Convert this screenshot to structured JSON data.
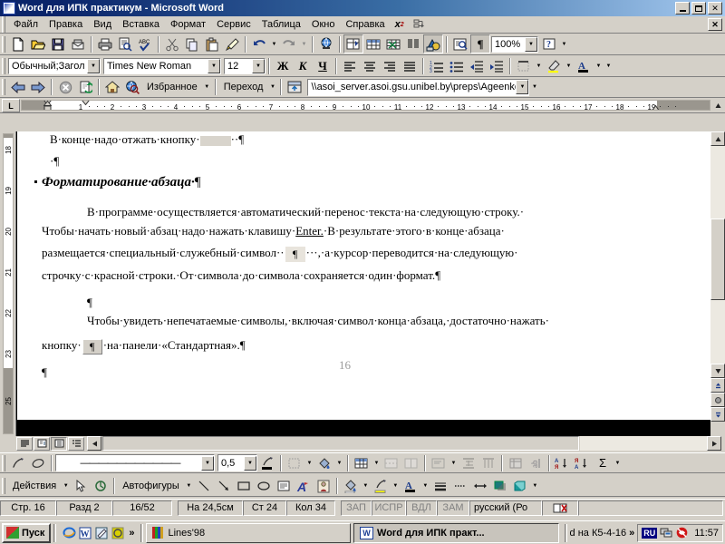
{
  "window": {
    "title": "Word для  ИПК практикум - Microsoft Word",
    "app_icon": "word-document-icon",
    "minimize": "_",
    "restore": "❐",
    "close": "✕"
  },
  "menubar": {
    "items": [
      {
        "label": "Файл",
        "accel": "Ф"
      },
      {
        "label": "Правка",
        "accel": "П"
      },
      {
        "label": "Вид",
        "accel": "и"
      },
      {
        "label": "Вставка",
        "accel": "а"
      },
      {
        "label": "Формат",
        "accel": "о"
      },
      {
        "label": "Сервис",
        "accel": "е"
      },
      {
        "label": "Таблица",
        "accel": "Т"
      },
      {
        "label": "Окно",
        "accel": "О"
      },
      {
        "label": "Справка",
        "accel": "С"
      }
    ],
    "superscript_icon": "x-squared-icon",
    "insert_field_icon": "insert-field-icon",
    "close_document": "✕"
  },
  "standard_toolbar": {
    "buttons": [
      {
        "name": "new-document-button",
        "glyph": "🗋"
      },
      {
        "name": "open-folder-button",
        "glyph": "🗀"
      },
      {
        "name": "save-button",
        "glyph": "💾"
      },
      {
        "name": "email-button",
        "glyph": "✉"
      },
      {
        "name": "print-button",
        "glyph": "🖶"
      },
      {
        "name": "print-preview-button",
        "glyph": "🔍"
      },
      {
        "name": "spelling-check-button",
        "glyph": "ABC"
      },
      {
        "name": "cut-button",
        "glyph": "✂"
      },
      {
        "name": "copy-button",
        "glyph": "⧉"
      },
      {
        "name": "paste-button",
        "glyph": "📋"
      },
      {
        "name": "format-painter-button",
        "glyph": "🖌"
      },
      {
        "name": "undo-button",
        "glyph": "↶"
      },
      {
        "name": "redo-button",
        "glyph": "↷"
      },
      {
        "name": "insert-hyperlink-button",
        "glyph": "🌐"
      },
      {
        "name": "tables-and-borders-button",
        "glyph": "⊞"
      },
      {
        "name": "insert-table-button",
        "glyph": "▦"
      },
      {
        "name": "insert-excel-sheet-button",
        "glyph": "▤"
      },
      {
        "name": "columns-button",
        "glyph": "▥"
      },
      {
        "name": "drawing-button",
        "glyph": "◆"
      },
      {
        "name": "document-map-button",
        "glyph": "🔎"
      },
      {
        "name": "show-formatting-marks-button",
        "glyph": "¶"
      },
      {
        "name": "help-button",
        "glyph": "?"
      }
    ],
    "zoom_value": "100%"
  },
  "formatting_toolbar": {
    "style_value": "Обычный;Загол",
    "font_value": "Times New Roman",
    "size_value": "12",
    "bold_label": "Ж",
    "italic_label": "К",
    "underline_label": "Ч",
    "buttons": [
      {
        "name": "align-left-button",
        "glyph": "≡"
      },
      {
        "name": "align-center-button",
        "glyph": "≡"
      },
      {
        "name": "align-right-button",
        "glyph": "≡"
      },
      {
        "name": "align-justify-button",
        "glyph": "≡"
      },
      {
        "name": "numbered-list-button",
        "glyph": "⒈"
      },
      {
        "name": "bulleted-list-button",
        "glyph": "•"
      },
      {
        "name": "decrease-indent-button",
        "glyph": "⇤"
      },
      {
        "name": "increase-indent-button",
        "glyph": "⇥"
      },
      {
        "name": "borders-button",
        "glyph": "▣"
      },
      {
        "name": "highlight-color-button",
        "glyph": "🖍"
      },
      {
        "name": "font-color-button",
        "glyph": "A"
      }
    ]
  },
  "web_toolbar": {
    "back_label": "⬅",
    "forward_label": "➡",
    "stop_label": "✖",
    "refresh_label": "⟳",
    "home_label": "⌂",
    "search_label": "search-web-icon",
    "favorites_label": "Избранное",
    "go_label": "Переход",
    "show_only_web_toolbar_label": "show-only-web-toolbar-icon",
    "address_value": "\\\\asoi_server.asoi.gsu.unibel.by\\preps\\Ageenko\\W("
  },
  "ruler": {
    "tab_stop_indicator": "L",
    "h_ticks": [
      "1",
      "2",
      "3",
      "4",
      "5",
      "6",
      "7",
      "8",
      "9",
      "10",
      "11",
      "12",
      "13",
      "14",
      "15",
      "16",
      "17",
      "18",
      "19"
    ],
    "v_ticks": [
      "18",
      "19",
      "20",
      "21",
      "22",
      "23",
      "25"
    ]
  },
  "document": {
    "line_top_partial": "В·конце·надо·отжать·кнопку·",
    "line_top_pilcrow": "¶",
    "empty_para_mark": "·¶",
    "heading": "Форматирование·абзаца·",
    "heading_mark": "¶",
    "para1_line1": "В·программе·осуществляется·автоматический·перенос·текста·на·следующую·строку.·",
    "para1_line2a": "Чтобы·начать·новый·абзац·надо·нажать·клавишу·",
    "para1_link": "Enter.",
    "para1_line2b": "·В·результате·этого·в·конце·абзаца·",
    "para1_line3a": "размещается·специальный·служебный·символ··",
    "para1_inline_mark": "¶",
    "para1_line3b": "···,·а·курсор·переводится·на·следующую·",
    "para1_line4": "строчку·с·красной·строки.·От·символа·до·символа·сохраняется·один·формат.",
    "para1_end_mark": "¶",
    "middle_mark": "¶",
    "para2_line1": "Чтобы·увидеть·непечатаемые·символы,·включая·символ·конца·абзаца,·достаточно·нажать·",
    "para2_line2a": "кнопку·",
    "para2_button_glyph": "¶",
    "para2_line2b": "·на·панели·«Стандартная».",
    "para2_end_mark": "¶",
    "footer_mark": "¶",
    "page_number": "16"
  },
  "view_buttons": [
    {
      "name": "normal-view-button",
      "glyph": "≡",
      "active": false
    },
    {
      "name": "web-layout-view-button",
      "glyph": "🖵",
      "active": false
    },
    {
      "name": "print-layout-view-button",
      "glyph": "▤",
      "active": true
    },
    {
      "name": "outline-view-button",
      "glyph": "⋮≡",
      "active": false
    }
  ],
  "tables_borders_toolbar": {
    "draw_table_label": "draw-table-pencil-icon",
    "eraser_label": "eraser-icon",
    "line_style_value": "———————————",
    "line_weight_value": "0,5",
    "border_color_label": "border-color-pencil-icon",
    "outside_border_label": "outside-border-icon",
    "shading_color_label": "shading-color-icon",
    "insert_table_label": "insert-table-icon",
    "merge_cells_label": "merge-cells-icon",
    "split_cells_label": "split-cells-icon",
    "align_label": "align-cell-icon",
    "distribute_rows_label": "distribute-rows-icon",
    "distribute_cols_label": "distribute-columns-icon",
    "table_autoformat_label": "table-autoformat-icon",
    "change_text_direction_label": "text-direction-icon",
    "sort_ascending_label": "А Я",
    "sort_descending_label": "Я А",
    "autosum_label": "Σ"
  },
  "drawing_toolbar": {
    "actions_label": "Действия",
    "select_objects_label": "select-arrow-icon",
    "free_rotate_label": "free-rotate-icon",
    "autoshapes_label": "Автофигуры",
    "line_label": "line-icon",
    "arrow_label": "arrow-icon",
    "rectangle_label": "rectangle-icon",
    "oval_label": "oval-icon",
    "text_box_label": "text-box-icon",
    "wordart_label": "wordart-icon",
    "clipart_label": "clip-art-icon",
    "fill_color_label": "fill-color-icon",
    "line_color_label": "line-color-icon",
    "font_color_label": "A",
    "line_style_label": "line-style-icon",
    "dash_style_label": "dash-style-icon",
    "arrow_style_label": "arrow-style-icon",
    "shadow_label": "shadow-icon",
    "3d_label": "3d-icon"
  },
  "statusbar": {
    "page": "Стр. 16",
    "section": "Разд 2",
    "page_of": "16/52",
    "at": "На 24,5см",
    "line": "Ст 24",
    "column": "Кол 34",
    "rec": "ЗАП",
    "trk": "ИСПР",
    "ext": "ВДЛ",
    "ovr": "ЗАМ",
    "language": "русский (Ро",
    "spellcheck_icon": "spelling-status-icon"
  },
  "taskbar": {
    "start_label": "Пуск",
    "quick_launch": [
      {
        "name": "internet-explorer-icon",
        "glyph": "e"
      },
      {
        "name": "word-icon",
        "glyph": "W"
      },
      {
        "name": "notepad-icon",
        "glyph": "✎"
      },
      {
        "name": "clock-icon",
        "glyph": "◎"
      }
    ],
    "quick_more": "»",
    "tasks": [
      {
        "name": "taskbar-item-lines98",
        "label": "Lines'98",
        "icon": "lines-game-icon",
        "active": false
      },
      {
        "name": "taskbar-item-word",
        "label": "Word для  ИПК практ...",
        "icon": "word-icon",
        "active": true
      }
    ],
    "tray_text": "d на К5-4-16",
    "tray_more": "»",
    "language_indicator": "RU",
    "network_icon": "network-icon",
    "antivirus_icon": "antivirus-icon",
    "clock": "11:57"
  },
  "colors": {
    "title_start": "#0a246a",
    "title_end": "#a6caf0",
    "face": "#d4d0c8",
    "desktop": "#808080",
    "link": "#000080"
  }
}
